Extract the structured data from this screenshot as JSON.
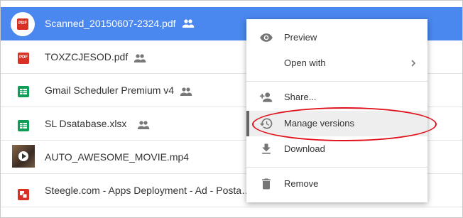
{
  "files": [
    {
      "name": "Scanned_20150607-2324.pdf",
      "icon": "pdf-icon",
      "shared": true,
      "selected": true
    },
    {
      "name": "TOXZCJESOD.pdf",
      "icon": "pdf-icon",
      "shared": true
    },
    {
      "name": "Gmail Scheduler Premium v4",
      "icon": "sheets-icon",
      "shared": true
    },
    {
      "name": "SL Dsatabase.xlsx",
      "icon": "sheets-icon",
      "shared": true
    },
    {
      "name": "AUTO_AWESOME_MOVIE.mp4",
      "icon": "video-thumbnail",
      "shared": false
    },
    {
      "name": "Steegle.com - Apps Deployment - Ad - Posta…",
      "icon": "slides-icon",
      "shared": false
    }
  ],
  "pdf_badge": "PDF",
  "context_menu": {
    "preview": "Preview",
    "open_with": "Open with",
    "share": "Share...",
    "manage_versions": "Manage versions",
    "download": "Download",
    "remove": "Remove"
  },
  "colors": {
    "selection": "#4a87ee",
    "pdf": "#d93025",
    "sheets": "#0f9d58",
    "annotation": "#e0101a"
  }
}
